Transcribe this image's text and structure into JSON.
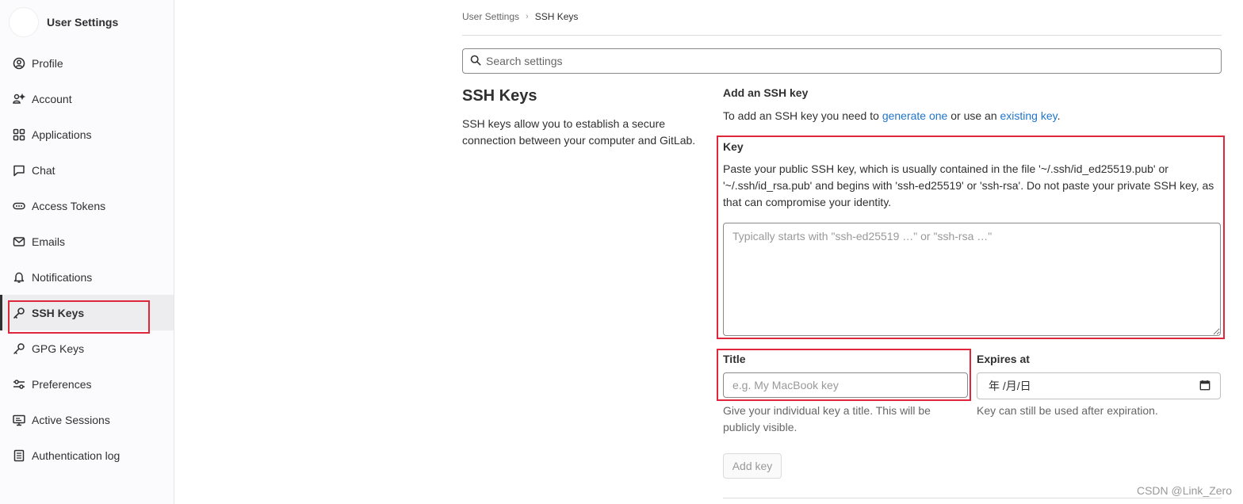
{
  "sidebar": {
    "title": "User Settings",
    "items": [
      {
        "label": "Profile",
        "icon": "profile-icon"
      },
      {
        "label": "Account",
        "icon": "account-icon"
      },
      {
        "label": "Applications",
        "icon": "applications-icon"
      },
      {
        "label": "Chat",
        "icon": "chat-icon"
      },
      {
        "label": "Access Tokens",
        "icon": "token-icon"
      },
      {
        "label": "Emails",
        "icon": "mail-icon"
      },
      {
        "label": "Notifications",
        "icon": "bell-icon"
      },
      {
        "label": "SSH Keys",
        "icon": "key-icon",
        "active": true
      },
      {
        "label": "GPG Keys",
        "icon": "key-icon"
      },
      {
        "label": "Preferences",
        "icon": "preferences-icon"
      },
      {
        "label": "Active Sessions",
        "icon": "monitor-icon"
      },
      {
        "label": "Authentication log",
        "icon": "log-icon"
      }
    ]
  },
  "breadcrumb": {
    "parent": "User Settings",
    "current": "SSH Keys"
  },
  "search": {
    "placeholder": "Search settings"
  },
  "section": {
    "title": "SSH Keys",
    "description": "SSH keys allow you to establish a secure connection between your computer and GitLab."
  },
  "form": {
    "heading": "Add an SSH key",
    "intro_prefix": "To add an SSH key you need to ",
    "intro_link1": "generate one",
    "intro_middle": " or use an ",
    "intro_link2": "existing key",
    "intro_suffix": ".",
    "key_label": "Key",
    "key_help": "Paste your public SSH key, which is usually contained in the file '~/.ssh/id_ed25519.pub' or '~/.ssh/id_rsa.pub' and begins with 'ssh-ed25519' or 'ssh-rsa'. Do not paste your private SSH key, as that can compromise your identity.",
    "key_placeholder": "Typically starts with \"ssh-ed25519 …\" or \"ssh-rsa …\"",
    "title_label": "Title",
    "title_placeholder": "e.g. My MacBook key",
    "title_help": "Give your individual key a title. This will be publicly visible.",
    "expires_label": "Expires at",
    "expires_value": "年 /月/日",
    "expires_help": "Key can still be used after expiration.",
    "submit_label": "Add key"
  },
  "watermark": "CSDN @Link_Zero",
  "colors": {
    "highlight": "#e0263b",
    "link": "#1f75cb"
  }
}
